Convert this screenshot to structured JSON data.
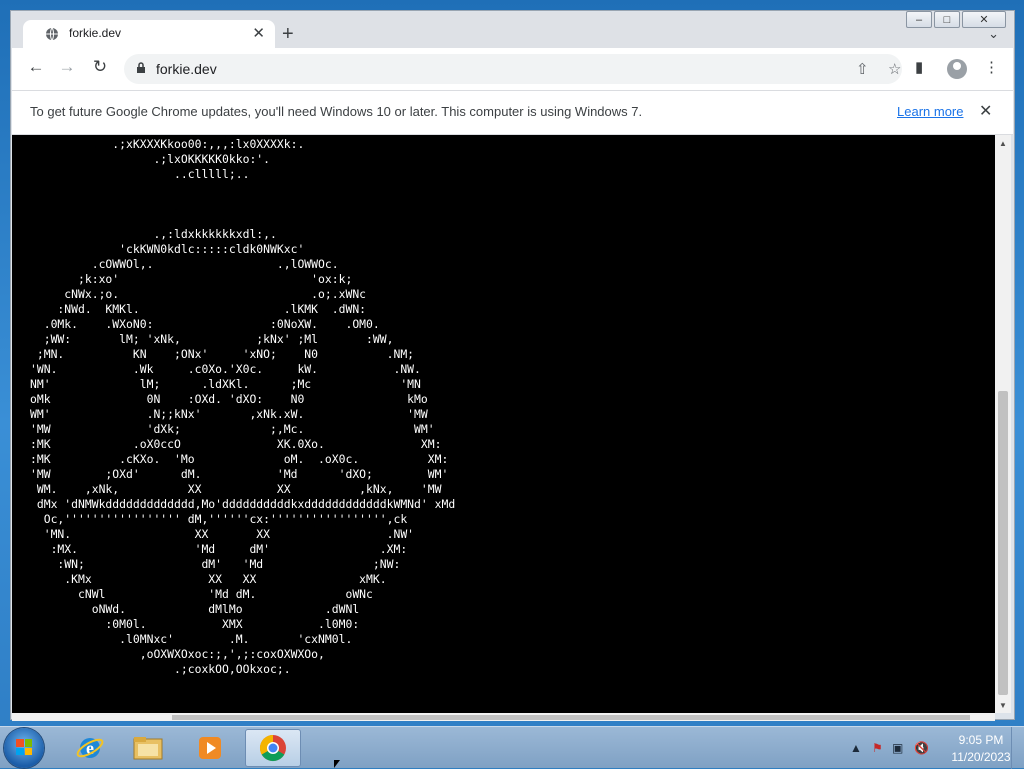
{
  "window": {
    "minimize": "–",
    "maximize": "□",
    "close": "✕"
  },
  "tab": {
    "title": "forkie.dev",
    "close": "✕"
  },
  "new_tab_label": "+",
  "tab_search": "⌄",
  "toolbar": {
    "back": "←",
    "forward": "→",
    "reload": "↻",
    "url": "forkie.dev",
    "share": "⇧",
    "star": "☆",
    "sidepanel": "▮",
    "menu": "⋮"
  },
  "infobar": {
    "message": "To get future Google Chrome updates, you'll need Windows 10 or later. This computer is using Windows 7.",
    "learn_more": "Learn more",
    "close": "✕"
  },
  "page": {
    "ascii_art": "            .;xKXXXKkoo00:,,,:lx0XXXXk:.\n                  .;lxOKKKKK0kko:'.\n                     ..clllll;..\n\n\n\n                  .,:ldxkkkkkkxdl:,.\n             'ckKWN0kdlc:::::cldk0NWKxc'\n         .cOWWOl,.                  .,lOWWOc.\n       ;k:xo'                            'ox:k;\n     cNWx.;o.                            .o;.xWNc\n    :NWd.  KMKl.                     .lKMK  .dWN:\n  .0Mk.    .WXoN0:                 :0NoXW.    .OM0.\n  ;WW:       lM; 'xNk,           ;kNx' ;Ml       :WW,\n ;MN.          KN    ;ONx'     'xNO;    N0          .NM;\n'WN.           .Wk     .c0Xo.'X0c.     kW.           .NW.\nNM'             lM;      .ldXKl.      ;Mc             'MN\noMk              0N    :OXd. 'dXO:    N0               kMo\nWM'              .N;;kNx'       ,xNk.xW.               'MW\n'MW              'dXk;             ;,Mc.                WM'\n:MK            .oX0ccO              XK.0Xo.              XM:\n:MK          .cKXo.  'Mo             oM.  .oX0c.          XM:\n'MW        ;OXd'      dM.           'Md      'dXO;        WM'\n WM.    ,xNk,          XX           XX          ,kNx,    'MW\n dMx 'dNMWkddddddddddddd,Mo'ddddddddddkxddddddddddddkWMNd' xMd\n  Oc,''''''''''''''''' dM,''''''cx:''''''''''''''''',ck\n  'MN.                  XX       XX                 .NW'\n   :MX.                 'Md     dM'                .XM:\n    :WN;                 dM'   'Md                ;NW:\n     .KMx                 XX   XX               xMK.\n       cNWl               'Md dM.             oWNc\n         oNWd.            dMlMo            .dWNl\n           :0M0l.           XMX           .l0M0:\n             .l0MNxc'        .M.       'cxNM0l.\n                ,oOXWXOxoc:;,',;:coxOXWXOo,\n                     .;coxkOO,OOkxoc;."
  },
  "taskbar": {
    "clock_time": "9:05 PM",
    "clock_date": "11/20/2023"
  },
  "colors": {
    "taskbar": "#8aaccc",
    "page_bg": "#000000",
    "ascii_fg": "#ffffff",
    "link": "#1a73e8"
  }
}
